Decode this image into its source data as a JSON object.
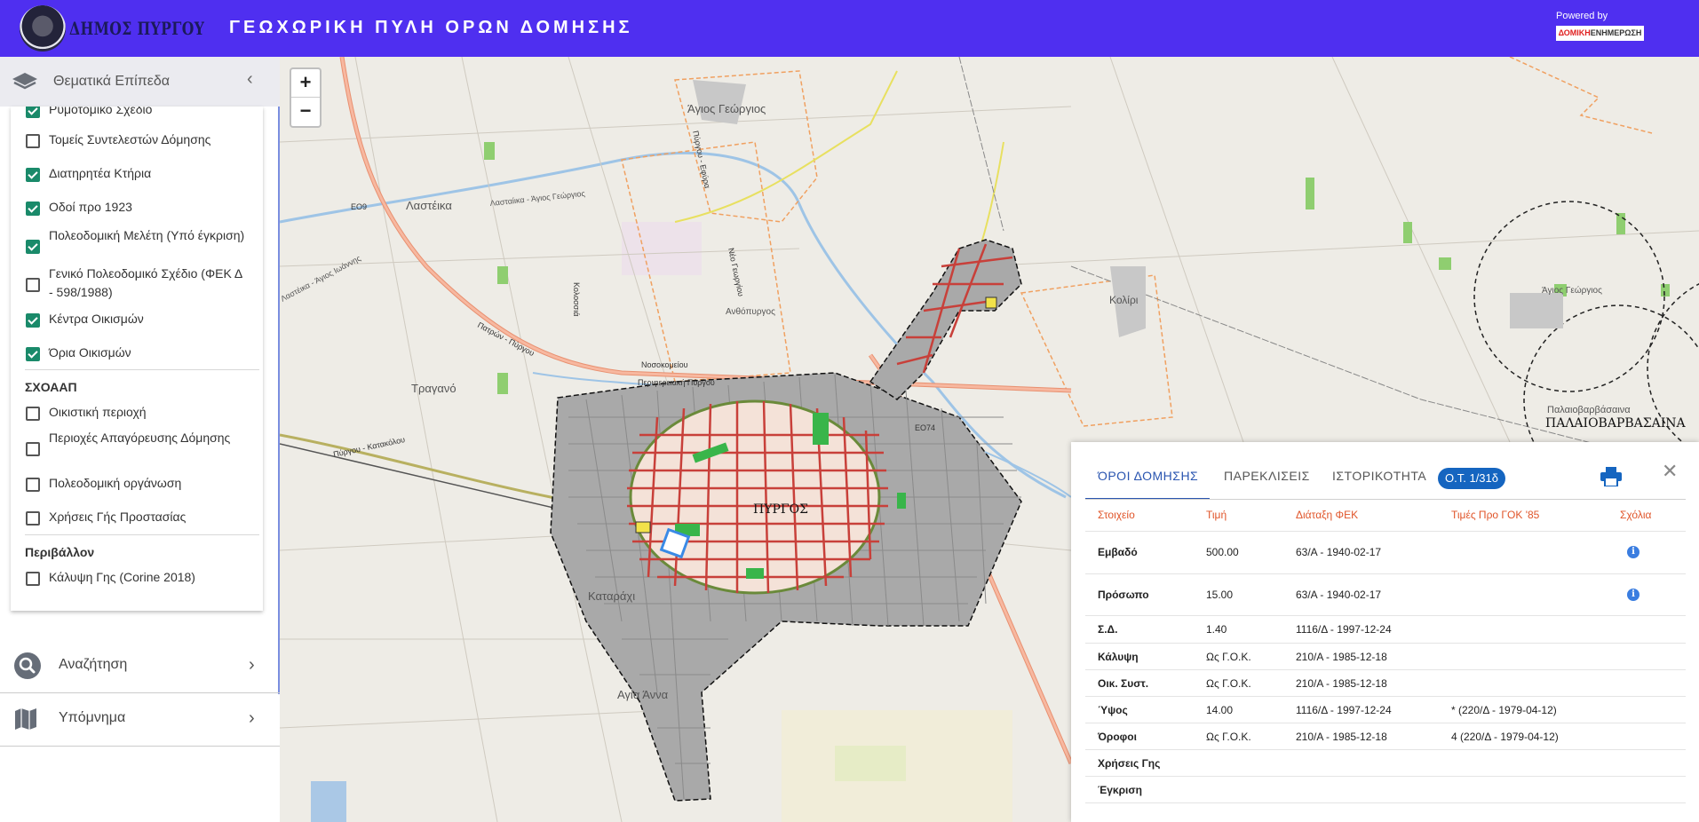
{
  "header": {
    "municipality": "ΔΗΜΟΣ ΠΥΡΓΟΥ",
    "title": "ΓΕΩΧΩΡΙΚΗ ΠΥΛΗ ΟΡΩΝ ΔΟΜΗΣΗΣ",
    "powered_by": "Powered by",
    "powered_brand_a": "ΔΟΜΙΚΗ",
    "powered_brand_b": "ΕΝΗΜΕΡΩΣΗ"
  },
  "sidebar": {
    "layers_title": "Θεματικά Επίπεδα",
    "layers": [
      {
        "label": "Ρυμοτομικό Σχέδιο",
        "checked": true
      },
      {
        "label": "Τομείς Συντελεστών Δόμησης",
        "checked": false
      },
      {
        "label": "Διατηρητέα Κτήρια",
        "checked": true
      },
      {
        "label": "Οδοί προ 1923",
        "checked": true
      },
      {
        "label": "Πολεοδομική Μελέτη (Υπό έγκριση)",
        "checked": true
      },
      {
        "label": "Γενικό Πολεοδομικό Σχέδιο (ΦΕΚ Δ - 598/1988)",
        "checked": false
      },
      {
        "label": "Κέντρα Οικισμών",
        "checked": true
      },
      {
        "label": "Όρια Οικισμών",
        "checked": true
      }
    ],
    "section_sxoaap": "ΣΧΟΑΑΠ",
    "sxoaap_layers": [
      {
        "label": "Οικιστική περιοχή",
        "checked": false
      },
      {
        "label": "Περιοχές Απαγόρευσης Δόμησης",
        "checked": false
      },
      {
        "label": "Πολεοδομική οργάνωση",
        "checked": false
      },
      {
        "label": "Χρήσεις Γής Προστασίας",
        "checked": false
      }
    ],
    "section_env": "Περιβάλλον",
    "env_layers": [
      {
        "label": "Κάλυψη Γης (Corine 2018)",
        "checked": false
      }
    ],
    "search_label": "Αναζήτηση",
    "legend_label": "Υπόμνημα"
  },
  "map": {
    "zoom_in": "+",
    "zoom_out": "−",
    "labels": {
      "agios_georgios": "Άγιος Γεώργιος",
      "lasteika": "Λαστέικα",
      "lasteika_road": "Λασταίικα - Άγιος Γεώργιος",
      "lasteika_road2": "Λαστέικα - Άγιος Ιωάννης",
      "e09": "ΕΟ9",
      "e074": "ΕΟ74",
      "anthopyrgos": "Ανθόπυργος",
      "kolossia": "Κολοσσιά",
      "nosokomeiou": "Νοσοκομείου",
      "perifereiaki": "Περιφερειακή Πύργου",
      "patron_pyrgou": "Πατρών - Πύργου",
      "traganos": "Τραγανό",
      "pyrgou_katakolou": "Πύργου - Κατακόλου",
      "pyrgos": "ΠΥΡΓΟΣ",
      "kataraktis": "Καταράχι",
      "agia_anna": "Αγία Άννα",
      "koliri": "Κολίρι",
      "agios_georgios_east": "Άγιος Γεώργιος",
      "palaiovarvasaina_small": "Παλαιοβαρβάσαινα",
      "palaiovarvasaina": "ΠΑΛΑΙΟΒΑΡΒΑΣΑΙΝΑ",
      "pyrgou_efyra": "Πύργου - Εφύρα",
      "neo_yorgiou": "Νέο Γεωργίου",
      "kolossiou": "Κολοσσιά"
    }
  },
  "panel": {
    "tabs": [
      "ΌΡΟΙ ΔΟΜΗΣΗΣ",
      "ΠΑΡΕΚΛΙΣΕΙΣ",
      "ΙΣΤΟΡΙΚΟΤΗΤΑ"
    ],
    "ot_badge": "Ο.Τ. 1/31δ",
    "columns": [
      "Στοιχείο",
      "Τιμή",
      "Διάταξη ΦΕΚ",
      "Τιμές Προ ΓΟΚ '85",
      "Σχόλια"
    ],
    "rows": [
      {
        "item": "Εμβαδό",
        "value": "500.00",
        "fek": "63/Α - 1940-02-17",
        "pre": "",
        "comment": "i"
      },
      {
        "item": "Πρόσωπο",
        "value": "15.00",
        "fek": "63/Α - 1940-02-17",
        "pre": "",
        "comment": "i"
      },
      {
        "item": "Σ.Δ.",
        "value": "1.40",
        "fek": "1116/Δ - 1997-12-24",
        "pre": "",
        "comment": ""
      },
      {
        "item": "Κάλυψη",
        "value": "Ως Γ.Ο.Κ.",
        "fek": "210/Α - 1985-12-18",
        "pre": "",
        "comment": ""
      },
      {
        "item": "Οικ. Συστ.",
        "value": "Ως Γ.Ο.Κ.",
        "fek": "210/Α - 1985-12-18",
        "pre": "",
        "comment": ""
      },
      {
        "item": "Ύψος",
        "value": "14.00",
        "fek": "1116/Δ - 1997-12-24",
        "pre": "* (220/Δ - 1979-04-12)",
        "comment": ""
      },
      {
        "item": "Όροφοι",
        "value": "Ως Γ.Ο.Κ.",
        "fek": "210/Α - 1985-12-18",
        "pre": "4 (220/Δ - 1979-04-12)",
        "comment": ""
      },
      {
        "item": "Χρήσεις Γης",
        "value": "",
        "fek": "",
        "pre": "",
        "comment": ""
      },
      {
        "item": "Έγκριση",
        "value": "",
        "fek": "",
        "pre": "",
        "comment": ""
      }
    ]
  },
  "colors": {
    "header_bg": "#4f2ff0",
    "accent_blue": "#1565c0",
    "table_header": "#e0552a",
    "check_green": "#1a8a6a"
  }
}
